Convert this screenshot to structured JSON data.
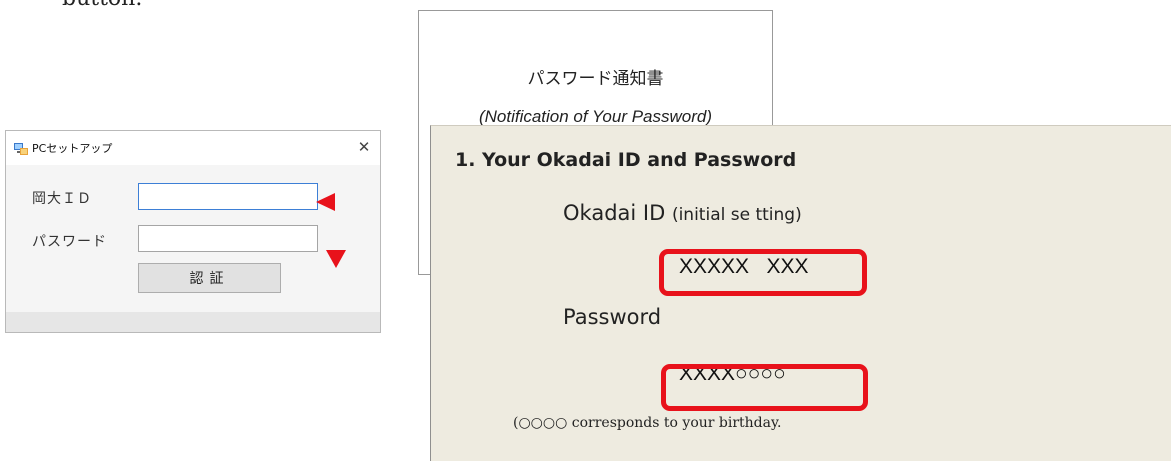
{
  "page": {
    "top_fragment": "button."
  },
  "dialog": {
    "title": "PCセットアップ",
    "close_symbol": "✕",
    "id_label": "岡大ＩＤ",
    "password_label": "パスワード",
    "id_value": "",
    "password_value": "",
    "auth_button_label": "認証"
  },
  "notice": {
    "title": "パスワード通知書",
    "subtitle": "(Notification of Your Password)"
  },
  "document": {
    "heading": "1.  Your Okadai ID and Password",
    "id_label_main": "Okadai ID",
    "id_label_note": "(initial se tting)",
    "id_value": "XXXXX   XXX",
    "password_label": "Password",
    "password_value": "XXXX○○○○",
    "birthday_note": "(○○○○ corresponds to your birthday."
  },
  "colors": {
    "highlight": "#e8121b",
    "doc_background": "#eeebe0",
    "dialog_background": "#f0f0f0",
    "focus_border": "#3d7fd6"
  },
  "icons": {
    "app_icon": "setup-app-icon",
    "close_icon": "close-icon",
    "arrows": "red-pointer-arrow-icon"
  }
}
